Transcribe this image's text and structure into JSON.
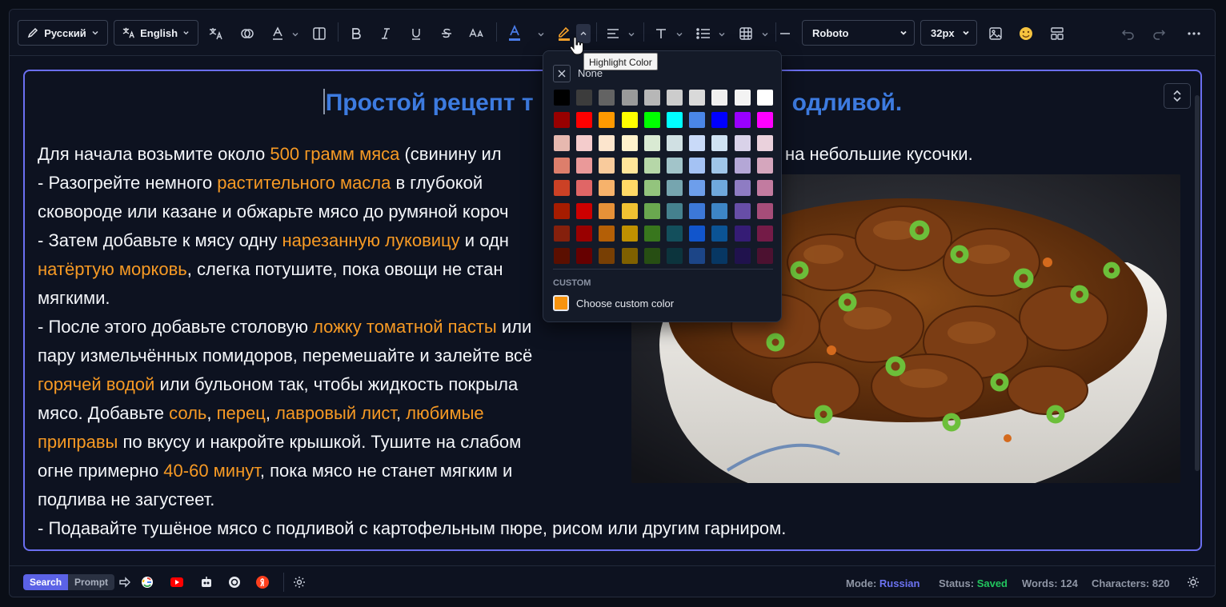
{
  "toolbar": {
    "source_lang": "Русский",
    "target_lang": "English",
    "font_family": "Roboto",
    "font_size": "32px",
    "text_color": "#4a7ce8",
    "highlight_color": "#f7a22b"
  },
  "tooltip": {
    "label": "Highlight Color"
  },
  "highlight_popup": {
    "none_label": "None",
    "custom_heading": "CUSTOM",
    "custom_label": "Choose custom color",
    "custom_swatch": "#f7930e",
    "grid": [
      [
        "#000000",
        "#3c3c3c",
        "#636363",
        "#9a9a9a",
        "#b7b7b7",
        "#cccccc",
        "#d9d9d9",
        "#efefef",
        "#f3f3f3",
        "#ffffff"
      ],
      [
        "#980000",
        "#ff0000",
        "#ff9900",
        "#ffff00",
        "#00ff00",
        "#00ffff",
        "#4a86e8",
        "#0000ff",
        "#9900ff",
        "#ff00ff"
      ],
      [
        "#e6b8af",
        "#f4cccc",
        "#fce5cd",
        "#fff2cc",
        "#d9ead3",
        "#d0e0e3",
        "#c9daf8",
        "#cfe2f3",
        "#d9d2e9",
        "#ead1dc"
      ],
      [
        "#dd7e6b",
        "#ea9999",
        "#f9cb9c",
        "#ffe599",
        "#b6d7a8",
        "#a2c4c9",
        "#a4c2f4",
        "#9fc5e8",
        "#b4a7d6",
        "#d5a6bd"
      ],
      [
        "#cc4125",
        "#e06666",
        "#f6b26b",
        "#ffd966",
        "#93c47d",
        "#76a5af",
        "#6d9eeb",
        "#6fa8dc",
        "#8e7cc3",
        "#c27ba0"
      ],
      [
        "#a61c00",
        "#cc0000",
        "#e69138",
        "#f1c232",
        "#6aa84f",
        "#45818e",
        "#3c78d8",
        "#3d85c6",
        "#674ea7",
        "#a64d79"
      ],
      [
        "#85200c",
        "#990000",
        "#b45f06",
        "#bf9000",
        "#38761d",
        "#134f5c",
        "#1155cc",
        "#0b5394",
        "#351c75",
        "#741b47"
      ],
      [
        "#5b0f00",
        "#660000",
        "#783f04",
        "#7f6000",
        "#274e13",
        "#0c343d",
        "#1c4587",
        "#073763",
        "#20124d",
        "#4c1130"
      ]
    ]
  },
  "document": {
    "title": {
      "visible_start": "Простой рецепт т",
      "visible_end": "одливой."
    },
    "lines": [
      [
        {
          "t": "Для начала возьмите около "
        },
        {
          "t": "500 грамм мяса",
          "h": 1
        },
        {
          "t": " (свинину ил"
        }
      ],
      [
        {
          "t": "- Разогрейте немного "
        },
        {
          "t": "растительного масла",
          "h": 1
        },
        {
          "t": " в глубокой"
        }
      ],
      [
        {
          "t": "сковороде или казане и обжарьте мясо до румяной короч"
        }
      ],
      [
        {
          "t": "- Затем добавьте к мясу одну "
        },
        {
          "t": "нарезанную луковицу",
          "h": 1
        },
        {
          "t": " и одн"
        }
      ],
      [
        {
          "t": "натёртую морковь",
          "h": 1
        },
        {
          "t": ", слегка потушите, пока овощи не стан"
        }
      ],
      [
        {
          "t": "мягкими."
        }
      ],
      [
        {
          "t": "- После этого добавьте столовую "
        },
        {
          "t": "ложку томатной пасты",
          "h": 1
        },
        {
          "t": " или"
        }
      ],
      [
        {
          "t": "пару измельчённых помидоров, перемешайте и залейте всё"
        }
      ],
      [
        {
          "t": "горячей водой",
          "h": 1
        },
        {
          "t": " или бульоном так, чтобы жидкость покрыла"
        }
      ],
      [
        {
          "t": "мясо. Добавьте "
        },
        {
          "t": "соль",
          "h": 1
        },
        {
          "t": ", "
        },
        {
          "t": "перец",
          "h": 1
        },
        {
          "t": ", "
        },
        {
          "t": "лавровый лист",
          "h": 1
        },
        {
          "t": ", "
        },
        {
          "t": "любимые",
          "h": 1
        }
      ],
      [
        {
          "t": "приправы",
          "h": 1
        },
        {
          "t": " по вкусу и накройте крышкой. Тушите на слабом"
        }
      ],
      [
        {
          "t": "огне примерно "
        },
        {
          "t": "40-60 минут",
          "h": 1
        },
        {
          "t": ", пока мясо не станет мягким и"
        }
      ],
      [
        {
          "t": "подлива не загустеет."
        }
      ],
      [
        {
          "t": "- Подавайте тушёное мясо с подливой с картофельным пюре, рисом или другим гарниром."
        }
      ]
    ],
    "right_fragment": "на небольшие кусочки."
  },
  "statusbar": {
    "search_label": "Search",
    "prompt_label": "Prompt",
    "mode_label": "Mode:",
    "mode_value": "Russian",
    "status_label": "Status:",
    "status_value": "Saved",
    "words_label": "Words:",
    "words_value": "124",
    "chars_label": "Characters:",
    "chars_value": "820",
    "mode_color": "#6b72f0",
    "status_color": "#22c55e"
  }
}
